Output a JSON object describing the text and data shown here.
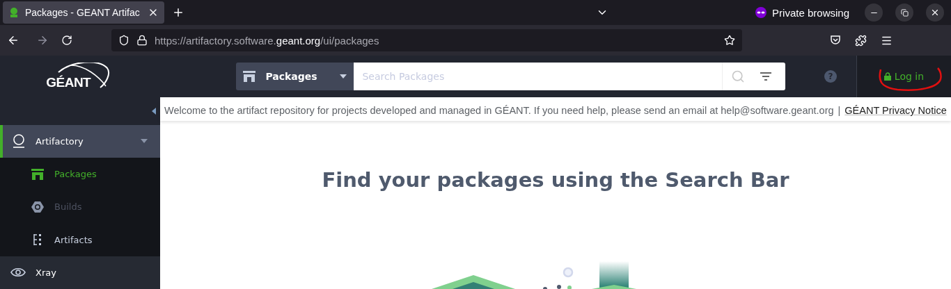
{
  "browser": {
    "tab": {
      "title": "Packages - GEANT Artifac",
      "selected": true
    },
    "private_label": "Private browsing",
    "url": {
      "prefix": "https://artifactory.software.",
      "host": "geant.org",
      "path": "/ui/packages"
    }
  },
  "header": {
    "logo": "GÉANT",
    "product_select": "Packages",
    "search": {
      "placeholder": "Search Packages"
    },
    "help": "?",
    "login": "Log in"
  },
  "banner": {
    "text": "Welcome to the artifact repository for projects developed and managed in GÉANT. If you need help, please send an email at help@software.geant.org",
    "separator": "|",
    "link": "GÉANT Privacy Notice"
  },
  "sidebar": {
    "items": [
      {
        "label": "Artifactory",
        "expanded": true,
        "selected": true,
        "children": [
          {
            "label": "Packages",
            "selected": true,
            "disabled": false
          },
          {
            "label": "Builds",
            "selected": false,
            "disabled": true
          },
          {
            "label": "Artifacts",
            "selected": false,
            "disabled": false
          }
        ]
      },
      {
        "label": "Xray",
        "expanded": false,
        "selected": false
      }
    ]
  },
  "main": {
    "heading": "Find your packages using the Search Bar"
  }
}
